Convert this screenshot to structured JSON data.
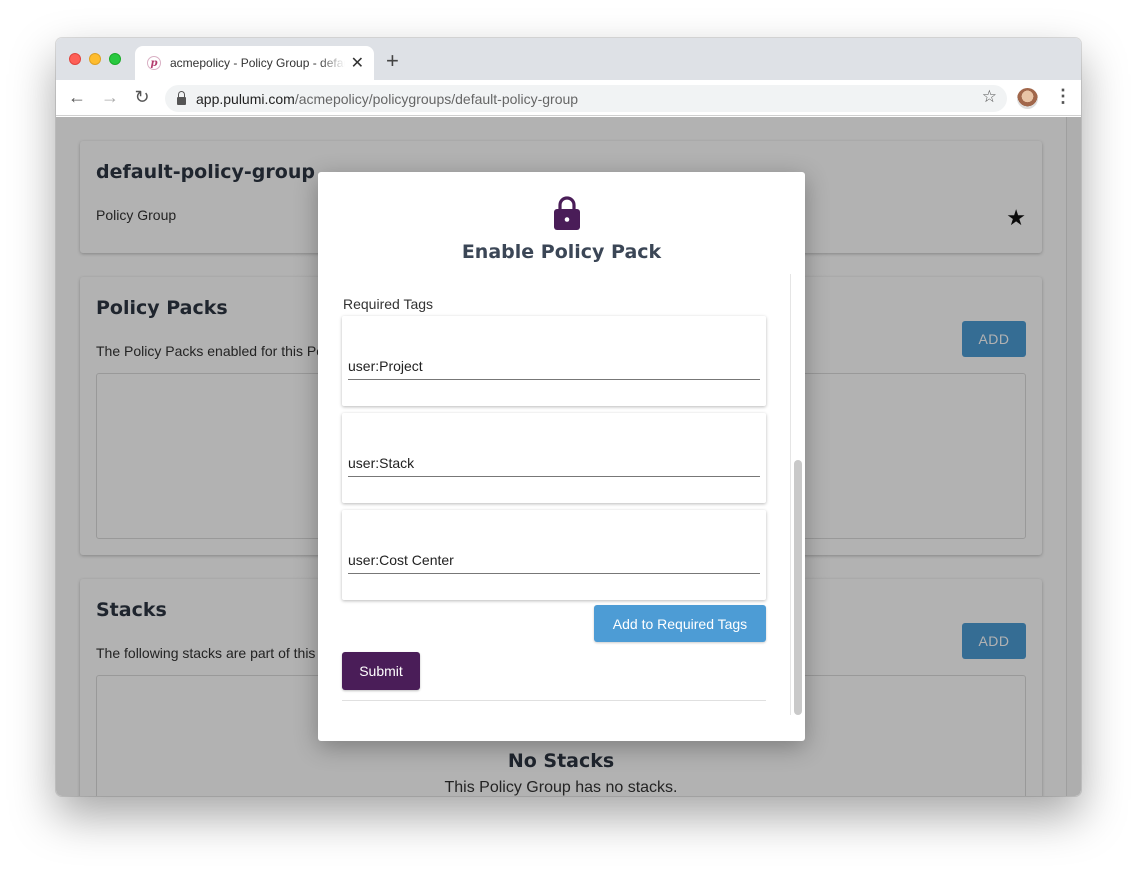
{
  "browser": {
    "tab_title": "acmepolicy - Policy Group - default-policy-group",
    "tab_favicon": "p",
    "url_host": "app.pulumi.com",
    "url_path": "/acmepolicy/policygroups/default-policy-group"
  },
  "page": {
    "header": {
      "title": "default-policy-group",
      "subtitle": "Policy Group"
    },
    "policy_packs": {
      "title": "Policy Packs",
      "description": "The Policy Packs enabled for this Policy Group.",
      "add_label": "ADD"
    },
    "stacks": {
      "title": "Stacks",
      "description": "The following stacks are part of this Policy Group.",
      "add_label": "ADD",
      "empty_title": "No Stacks",
      "empty_text": "This Policy Group has no stacks."
    }
  },
  "modal": {
    "title": "Enable Policy Pack",
    "section_label": "Required Tags",
    "tags": [
      "user:Project",
      "user:Stack",
      "user:Cost Center"
    ],
    "add_tags_label": "Add to Required Tags",
    "submit_label": "Submit"
  },
  "colors": {
    "primary_blue": "#4d9cd5",
    "submit_purple": "#4a1d58",
    "lock_purple": "#4a1d58"
  }
}
